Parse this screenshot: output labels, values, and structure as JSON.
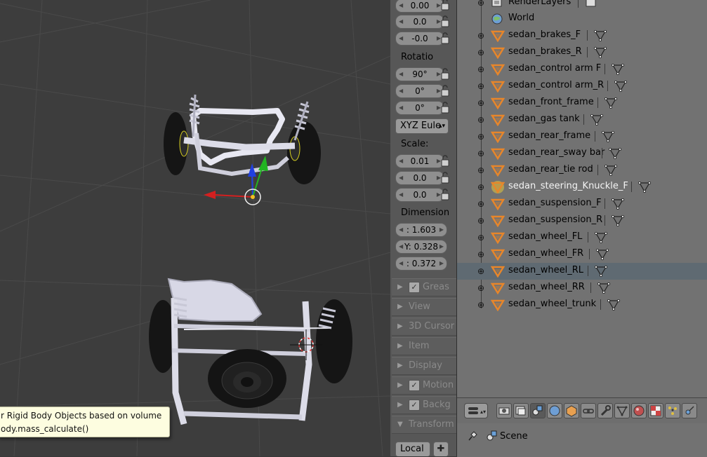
{
  "tooltip": {
    "line1": "r Rigid Body Objects based on volume",
    "line2": "ody.mass_calculate()"
  },
  "npanel": {
    "location": [
      "0.00",
      "0.0",
      "-0.0"
    ],
    "rotation_label": "Rotatio",
    "rotation": [
      "90°",
      "0°",
      "0°"
    ],
    "rotation_mode": "XYZ Eule",
    "scale_label": "Scale:",
    "scale": [
      "0.01",
      "0.0",
      "0.0"
    ],
    "dimensions_label": "Dimension",
    "dimensions": [
      ": 1.603",
      "Y: 0.328",
      ": 0.372"
    ],
    "sections": [
      {
        "label": "Greas",
        "checkbox": true
      },
      {
        "label": "View",
        "checkbox": false
      },
      {
        "label": "3D Cursor",
        "checkbox": false
      },
      {
        "label": "Item",
        "checkbox": false
      },
      {
        "label": "Display",
        "checkbox": false
      },
      {
        "label": "Motion",
        "checkbox": true
      },
      {
        "label": "Backg",
        "checkbox": true
      },
      {
        "label": "Transform",
        "checkbox": false,
        "expanded": true
      }
    ],
    "transform_orientation": "Local"
  },
  "outliner": {
    "render_layers": "RenderLayers",
    "world": "World",
    "objects": [
      "sedan_brakes_F",
      "sedan_brakes_R",
      "sedan_control arm F",
      "sedan_control arm_R",
      "sedan_front_frame",
      "sedan_gas tank",
      "sedan_rear_frame",
      "sedan_rear_sway bar",
      "sedan_rear_tie rod",
      "sedan_steering_Knuckle_F",
      "sedan_suspension_F",
      "sedan_suspension_R",
      "sedan_wheel_FL",
      "sedan_wheel_FR",
      "sedan_wheel_RL",
      "sedan_wheel_RR",
      "sedan_wheel_trunk"
    ],
    "selected": "sedan_wheel_RL",
    "highlighted": "sedan_steering_Knuckle_F"
  },
  "properties": {
    "context_label": "Scene"
  },
  "colors": {
    "outliner_bg": "#727272",
    "panel_bg": "#575757",
    "viewport_bg": "#3d3d3d",
    "selected_row": "#5f6a72",
    "tooltip_bg": "#fdfde0",
    "object_icon": "#e8862a",
    "axis_x": "#d42020",
    "axis_y": "#22b422",
    "axis_z": "#2040e0"
  }
}
